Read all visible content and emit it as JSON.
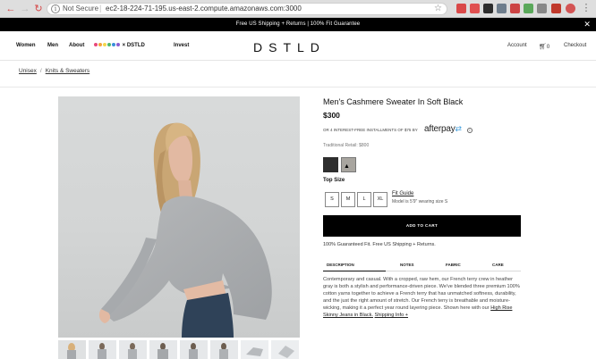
{
  "browser": {
    "security_label": "Not Secure",
    "url": "ec2-18-224-71-195.us-east-2.compute.amazonaws.com:3000"
  },
  "promo": {
    "text": "Free US Shipping + Returns | 100% Fit Guarantee"
  },
  "header": {
    "nav": [
      "Women",
      "Men",
      "About"
    ],
    "brand_link": "× DSTLD",
    "invest": "Invest",
    "logo": "DSTLD",
    "account": "Account",
    "cart_count": "0",
    "checkout": "Checkout"
  },
  "breadcrumb": {
    "items": [
      "Unisex",
      "Knits & Sweaters"
    ]
  },
  "product": {
    "title": "Men's Cashmere Sweater In Soft Black",
    "price": "$300",
    "afterpay_text": "OR 4 INTEREST-FREE INSTALLMENTS OF $75 BY",
    "afterpay_logo": "afterpay",
    "afterpay_info": "i",
    "traditional_retail": "Traditional Retail: $800",
    "size_label": "Top Size",
    "sizes": [
      "S",
      "M",
      "L",
      "XL"
    ],
    "fit_guide": "Fit Guide",
    "model_note": "Model is 5'9\" wearing size S",
    "add_to_cart": "ADD TO CART",
    "guarantee": "100% Guaranteed Fit. Free US Shipping + Returns.",
    "tabs": [
      "DESCRIPTION",
      "NOTES",
      "FABRIC",
      "CARE"
    ],
    "description": "Contemporary and casual. With a cropped, raw hem, our French terry crew in heather gray is both a stylish and performance-driven piece. We've blended three premium 100% cotton yarns together to achieve a French terry that has unmatched softness, durability, and the just the right amount of stretch. Our French terry is breathable and moisture-wicking, making it a perfect year round layering piece. Shown here with our ",
    "description_link": "High Rise Skinny Jeans in Black.",
    "shipping_info": "Shipping Info +"
  },
  "colors": {
    "swatch_black": "#2e2e2e",
    "swatch_gray": "#a8a59f",
    "afterpay_accent": "#4aa3df"
  }
}
